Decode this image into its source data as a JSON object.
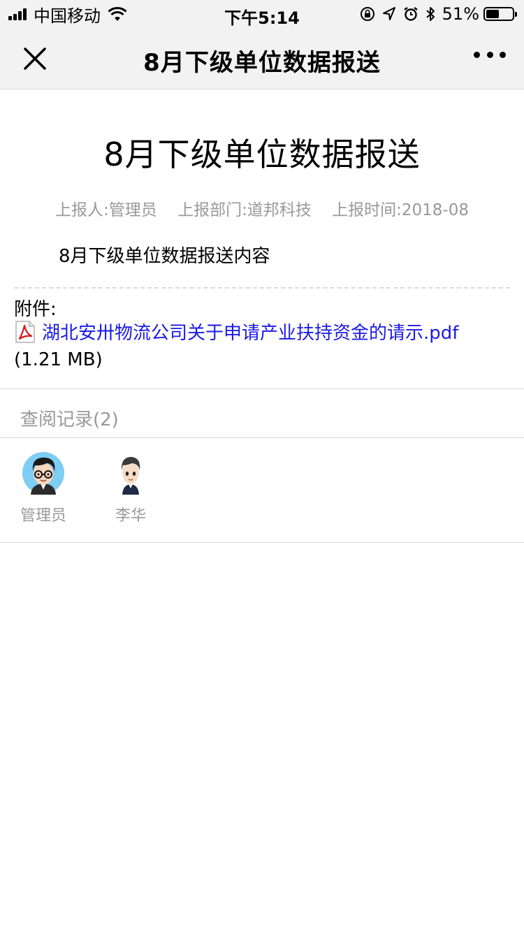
{
  "status_bar": {
    "carrier": "中国移动",
    "time": "下午5:14",
    "battery_percent": "51%",
    "battery_level": 0.51,
    "icons": [
      "signal-icon",
      "wifi-icon",
      "rotation-lock-icon",
      "location-icon",
      "alarm-icon",
      "bluetooth-icon",
      "battery-icon"
    ]
  },
  "nav": {
    "title": "8月下级单位数据报送",
    "close_icon": "close-icon",
    "more_icon": "more-icon"
  },
  "article": {
    "title": "8月下级单位数据报送",
    "reporter": "上报人:管理员",
    "department": "上报部门:道邦科技",
    "report_time": "上报时间:2018-08",
    "content": "8月下级单位数据报送内容"
  },
  "attachment": {
    "label": "附件:",
    "file_name": "湖北安卅物流公司关于申请产业扶持资金的请示.pdf",
    "file_size": "(1.21 MB)",
    "link_color": "#1a1ae6"
  },
  "read_records": {
    "title": "查阅记录(2)",
    "readers": [
      {
        "name": "管理员",
        "avatar": "avatar-glasses"
      },
      {
        "name": "李华",
        "avatar": "avatar-boy"
      }
    ]
  }
}
